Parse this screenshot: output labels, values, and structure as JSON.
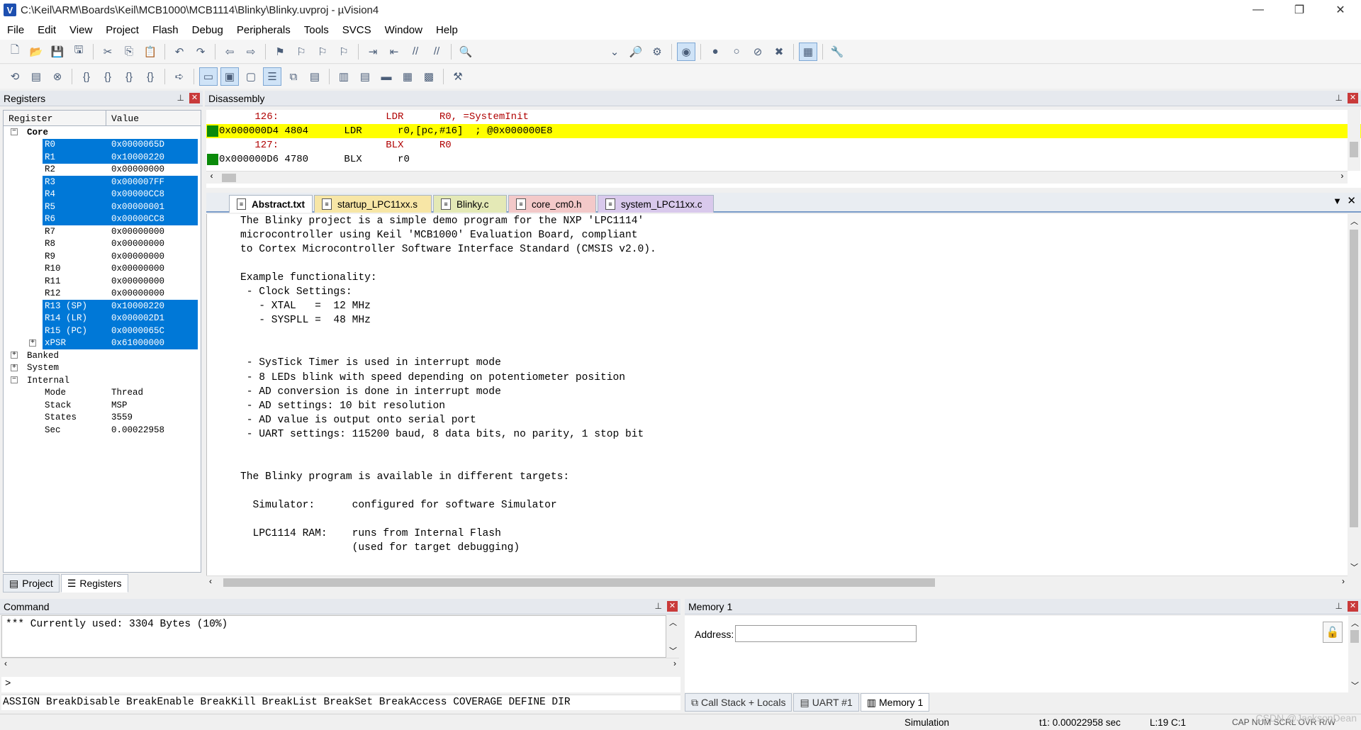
{
  "window": {
    "title": "C:\\Keil\\ARM\\Boards\\Keil\\MCB1000\\MCB1114\\Blinky\\Blinky.uvproj - µVision4",
    "controls": [
      "—",
      "❐",
      "✕"
    ]
  },
  "menu": [
    "File",
    "Edit",
    "View",
    "Project",
    "Flash",
    "Debug",
    "Peripherals",
    "Tools",
    "SVCS",
    "Window",
    "Help"
  ],
  "registers": {
    "panel_title": "Registers",
    "col_register": "Register",
    "col_value": "Value",
    "groups": {
      "core": "Core",
      "banked": "Banked",
      "system": "System",
      "internal": "Internal"
    },
    "core": [
      {
        "name": "R0",
        "value": "0x0000065D",
        "highlighted": true
      },
      {
        "name": "R1",
        "value": "0x10000220",
        "highlighted": true
      },
      {
        "name": "R2",
        "value": "0x00000000",
        "highlighted": false
      },
      {
        "name": "R3",
        "value": "0x000007FF",
        "highlighted": true
      },
      {
        "name": "R4",
        "value": "0x00000CC8",
        "highlighted": true
      },
      {
        "name": "R5",
        "value": "0x00000001",
        "highlighted": true
      },
      {
        "name": "R6",
        "value": "0x00000CC8",
        "highlighted": true
      },
      {
        "name": "R7",
        "value": "0x00000000",
        "highlighted": false
      },
      {
        "name": "R8",
        "value": "0x00000000",
        "highlighted": false
      },
      {
        "name": "R9",
        "value": "0x00000000",
        "highlighted": false
      },
      {
        "name": "R10",
        "value": "0x00000000",
        "highlighted": false
      },
      {
        "name": "R11",
        "value": "0x00000000",
        "highlighted": false
      },
      {
        "name": "R12",
        "value": "0x00000000",
        "highlighted": false
      },
      {
        "name": "R13 (SP)",
        "value": "0x10000220",
        "highlighted": true
      },
      {
        "name": "R14 (LR)",
        "value": "0x000002D1",
        "highlighted": true
      },
      {
        "name": "R15 (PC)",
        "value": "0x0000065C",
        "highlighted": true
      },
      {
        "name": "xPSR",
        "value": "0x61000000",
        "highlighted": true
      }
    ],
    "internal": [
      {
        "name": "Mode",
        "value": "Thread"
      },
      {
        "name": "Stack",
        "value": "MSP"
      },
      {
        "name": "States",
        "value": "3559"
      },
      {
        "name": "Sec",
        "value": "0.00022958"
      }
    ]
  },
  "left_tabs": {
    "project": "Project",
    "registers": "Registers"
  },
  "disassembly": {
    "panel_title": "Disassembly",
    "lines": [
      {
        "text": "      126:                  LDR      R0, =SystemInit",
        "kind": "src"
      },
      {
        "text": "0x000000D4 4804      LDR      r0,[pc,#16]  ; @0x000000E8",
        "kind": "cur"
      },
      {
        "text": "      127:                  BLX      R0",
        "kind": "src"
      },
      {
        "text": "0x000000D6 4780      BLX      r0",
        "kind": "asm"
      }
    ]
  },
  "editor": {
    "tabs": [
      {
        "label": "Abstract.txt",
        "color": "#cfd8e6",
        "active": true
      },
      {
        "label": "startup_LPC11xx.s",
        "color": "#f7e6a6",
        "active": false
      },
      {
        "label": "Blinky.c",
        "color": "#e4e9b6",
        "active": false
      },
      {
        "label": "core_cm0.h",
        "color": "#f3c9c9",
        "active": false
      },
      {
        "label": "system_LPC11xx.c",
        "color": "#d9c9ec",
        "active": false
      }
    ],
    "lines": [
      "The Blinky project is a simple demo program for the NXP 'LPC1114'",
      "microcontroller using Keil 'MCB1000' Evaluation Board, compliant",
      "to Cortex Microcontroller Software Interface Standard (CMSIS v2.0).",
      "",
      "Example functionality:",
      " - Clock Settings:",
      "   - XTAL   =  12 MHz",
      "   - SYSPLL =  48 MHz",
      "",
      "",
      " - SysTick Timer is used in interrupt mode",
      " - 8 LEDs blink with speed depending on potentiometer position",
      " - AD conversion is done in interrupt mode",
      " - AD settings: 10 bit resolution",
      " - AD value is output onto serial port",
      " - UART settings: 115200 baud, 8 data bits, no parity, 1 stop bit",
      "",
      "",
      "The Blinky program is available in different targets:",
      "",
      "  Simulator:      configured for software Simulator",
      "",
      "  LPC1114 RAM:    runs from Internal Flash",
      "                  (used for target debugging)"
    ]
  },
  "command": {
    "panel_title": "Command",
    "output": "*** Currently used: 3304 Bytes (10%)",
    "prompt": ">",
    "help": "ASSIGN BreakDisable BreakEnable BreakKill BreakList BreakSet BreakAccess COVERAGE DEFINE DIR"
  },
  "memory": {
    "panel_title": "Memory 1",
    "address_label": "Address:",
    "address_value": ""
  },
  "bottom_tabs": [
    "Call Stack + Locals",
    "UART #1",
    "Memory 1"
  ],
  "status": {
    "mode": "Simulation",
    "time": "t1: 0.00022958 sec",
    "position": "L:19 C:1",
    "keys": "CAP  NUM  SCRL  OVR  R/W",
    "watermark": "CSDN @JacksonDean"
  },
  "colors": {
    "selection": "#0078d7",
    "current_line": "#ffff00",
    "source_line": "#b00000",
    "exec_marker": "#0a8a0a"
  }
}
